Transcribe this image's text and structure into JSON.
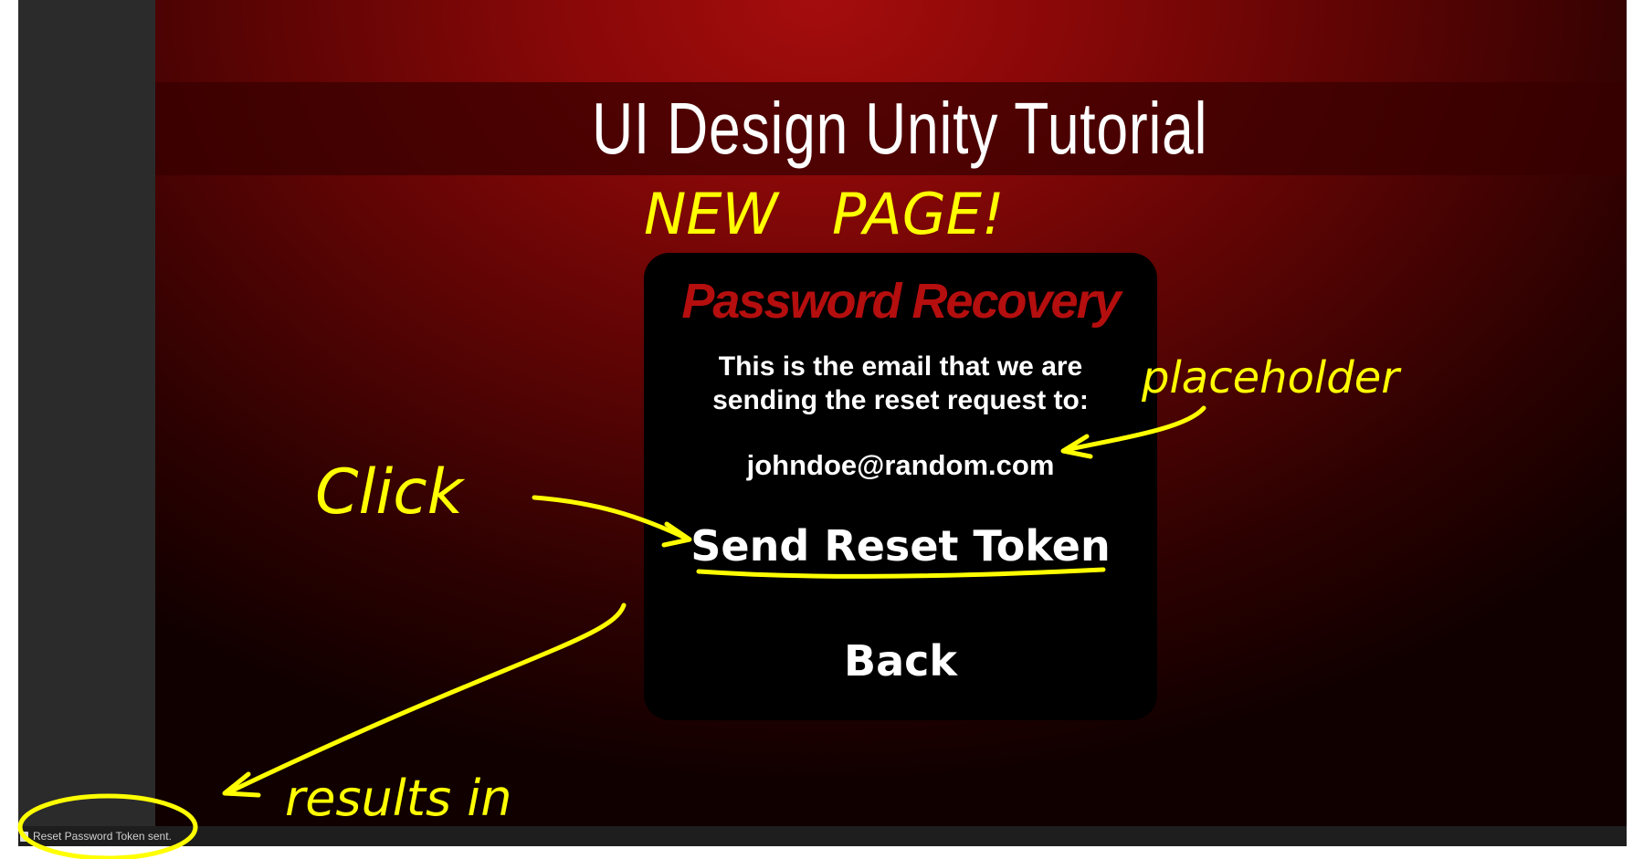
{
  "game": {
    "title": "UI Design Unity Tutorial",
    "panel": {
      "title": "Password Recovery",
      "description": "This is the email that we are\nsending the reset request to:",
      "email_value": "johndoe@random.com",
      "send_button_label": "Send Reset Token",
      "back_button_label": "Back"
    }
  },
  "console": {
    "icon": "info-icon",
    "message": "Reset Password Token sent."
  },
  "annotations": {
    "new_page": "NEW   PAGE!",
    "placeholder": "placeholder",
    "click": "Click",
    "results_in": "results in",
    "color": "#ffff00"
  },
  "colors": {
    "panel_title": "#b50e0e",
    "background_red": "#8a0808",
    "panel_bg": "#000000"
  }
}
